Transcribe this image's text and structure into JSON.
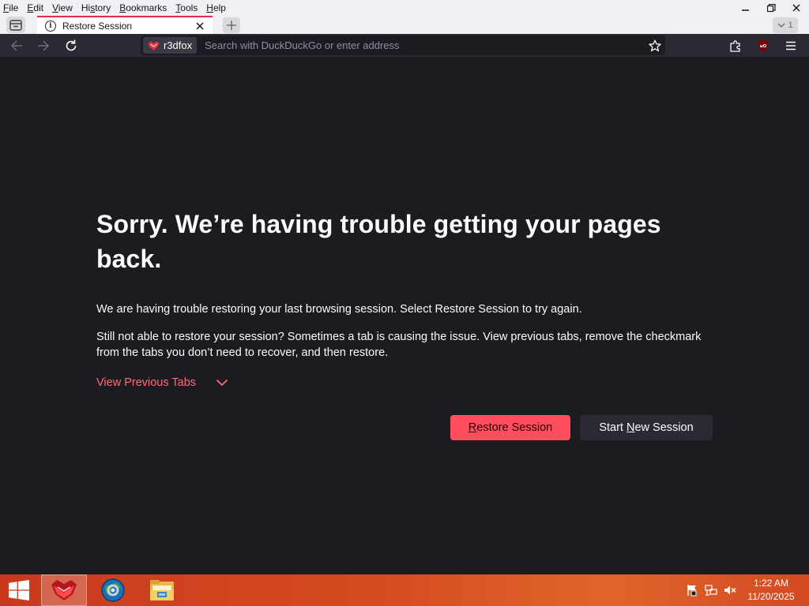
{
  "menubar": {
    "items": [
      {
        "mnemonic": "F",
        "rest": "ile"
      },
      {
        "mnemonic": "E",
        "rest": "dit"
      },
      {
        "mnemonic": "V",
        "rest": "iew"
      },
      {
        "pre": "Hi",
        "mnemonic": "s",
        "rest": "tory"
      },
      {
        "mnemonic": "B",
        "rest": "ookmarks"
      },
      {
        "mnemonic": "T",
        "rest": "ools"
      },
      {
        "mnemonic": "H",
        "rest": "elp"
      }
    ]
  },
  "window_controls": {
    "icons": [
      "minimize-icon",
      "restore-icon",
      "close-icon"
    ]
  },
  "tabs": {
    "active": {
      "title": "Restore Session",
      "icon": "info-icon"
    },
    "tab_count": "1"
  },
  "navbar": {
    "identity_label": "r3dfox",
    "url_placeholder": "Search with DuckDuckGo or enter address",
    "url_value": ""
  },
  "error_page": {
    "title": "Sorry. We’re having trouble getting your pages back.",
    "description_1": "We are having trouble restoring your last browsing session. Select Restore Session to try again.",
    "description_2": "Still not able to restore your session? Sometimes a tab is causing the issue. View previous tabs, remove the checkmark from the tabs you don’t need to recover, and then restore.",
    "view_previous_tabs": "View Previous Tabs",
    "restore_button": {
      "accel": "R",
      "rest": "estore Session"
    },
    "new_session_button": {
      "pre": "Start ",
      "accel": "N",
      "rest": "ew Session"
    }
  },
  "taskbar": {
    "apps": [
      "r3dfox-app-icon",
      "browser-globe-icon",
      "file-explorer-icon"
    ],
    "clock_time": "1:22 AM",
    "clock_date": "11/20/2025"
  },
  "colors": {
    "accent": "#ff4f5e",
    "link": "#ff6a75",
    "tab_accent": "#e22850",
    "page_bg": "#1c1b22",
    "toolbar_bg": "#2b2a33"
  }
}
